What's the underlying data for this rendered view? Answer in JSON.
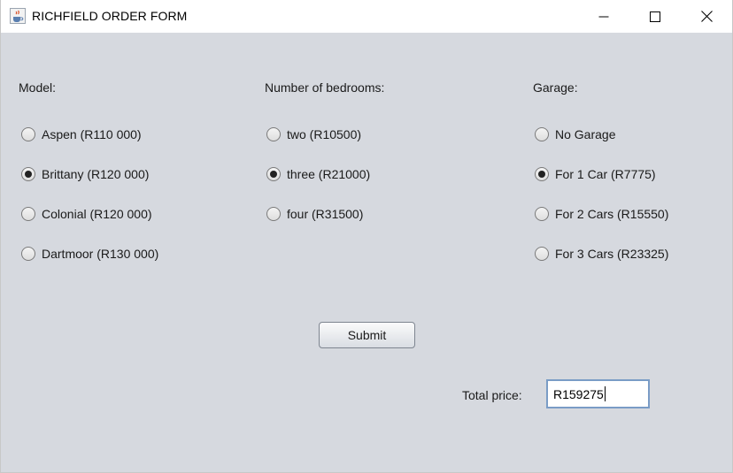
{
  "window": {
    "title": "RICHFIELD ORDER FORM",
    "icon": "java-cup-icon"
  },
  "model": {
    "label": "Model:",
    "options": [
      {
        "label": "Aspen (R110 000)",
        "checked": false
      },
      {
        "label": "Brittany (R120 000)",
        "checked": true
      },
      {
        "label": "Colonial (R120 000)",
        "checked": false
      },
      {
        "label": "Dartmoor (R130 000)",
        "checked": false
      }
    ]
  },
  "bedrooms": {
    "label": "Number of bedrooms:",
    "options": [
      {
        "label": "two (R10500)",
        "checked": false
      },
      {
        "label": "three (R21000)",
        "checked": true
      },
      {
        "label": "four (R31500)",
        "checked": false
      }
    ]
  },
  "garage": {
    "label": "Garage:",
    "options": [
      {
        "label": "No Garage",
        "checked": false
      },
      {
        "label": "For 1 Car (R7775)",
        "checked": true
      },
      {
        "label": "For 2 Cars (R15550)",
        "checked": false
      },
      {
        "label": "For 3 Cars (R23325)",
        "checked": false
      }
    ]
  },
  "actions": {
    "submit_label": "Submit"
  },
  "total": {
    "label": "Total price:",
    "value": "R159275"
  }
}
